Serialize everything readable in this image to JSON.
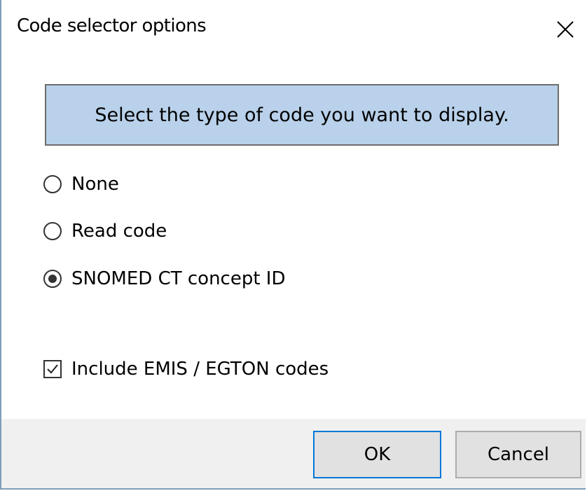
{
  "window": {
    "title": "Code selector options",
    "close_icon": "close-icon"
  },
  "info": {
    "text": "Select the type of code you want to display."
  },
  "code_type": {
    "options": [
      {
        "label": "None",
        "selected": false
      },
      {
        "label": "Read code",
        "selected": false
      },
      {
        "label": "SNOMED CT concept ID",
        "selected": true
      }
    ]
  },
  "include_codes": {
    "label": "Include EMIS / EGTON codes",
    "checked": true
  },
  "footer": {
    "ok_label": "OK",
    "cancel_label": "Cancel"
  },
  "colors": {
    "info_background": "#b9d1ea",
    "footer_background": "#f0f0f0",
    "ok_border": "#0078d7"
  }
}
